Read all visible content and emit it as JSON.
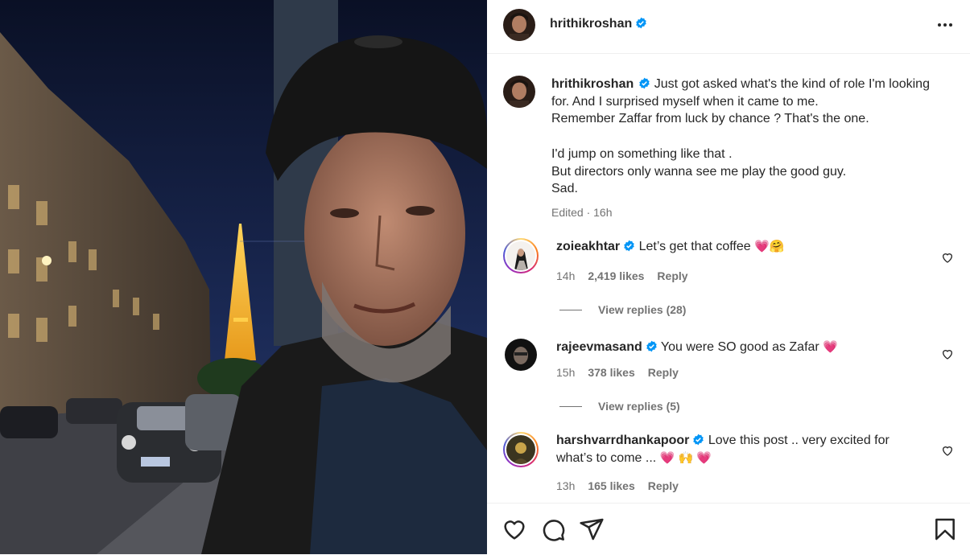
{
  "post": {
    "username": "hrithikroshan",
    "caption_lines": [
      "Just got asked what's the kind of role I'm looking",
      "for. And I surprised myself when it came to me.",
      "Remember Zaffar from luck by chance ? That's the one.",
      "",
      "I'd jump on something like that .",
      "But directors only wanna see me play the good guy.",
      "Sad."
    ],
    "edited_meta": "Edited · 16h"
  },
  "comments": [
    {
      "username": "zoieakhtar",
      "text": "Let’s get that coffee",
      "emojis": "💗🤗",
      "time": "14h",
      "likes": "2,419 likes",
      "reply": "Reply",
      "view_replies": "View replies (28)"
    },
    {
      "username": "rajeevmasand",
      "text": "You were SO good as Zafar",
      "emojis": "💗",
      "time": "15h",
      "likes": "378 likes",
      "reply": "Reply",
      "view_replies": "View replies (5)"
    },
    {
      "username": "harshvarrdhankapoor",
      "text": "Love this post .. very excited for",
      "text2": "what’s to come ...",
      "emojis": "💗 🙌 💗",
      "time": "13h",
      "likes": "165 likes",
      "reply": "Reply"
    }
  ],
  "icons": {
    "verified": "verified-badge-icon",
    "more": "more-options-icon",
    "like": "heart-icon",
    "comment": "comment-icon",
    "share": "share-icon",
    "save": "bookmark-icon"
  },
  "colors": {
    "verified_blue": "#0095f6",
    "muted_text": "#737373",
    "emoji_heart": "#e8336d"
  }
}
